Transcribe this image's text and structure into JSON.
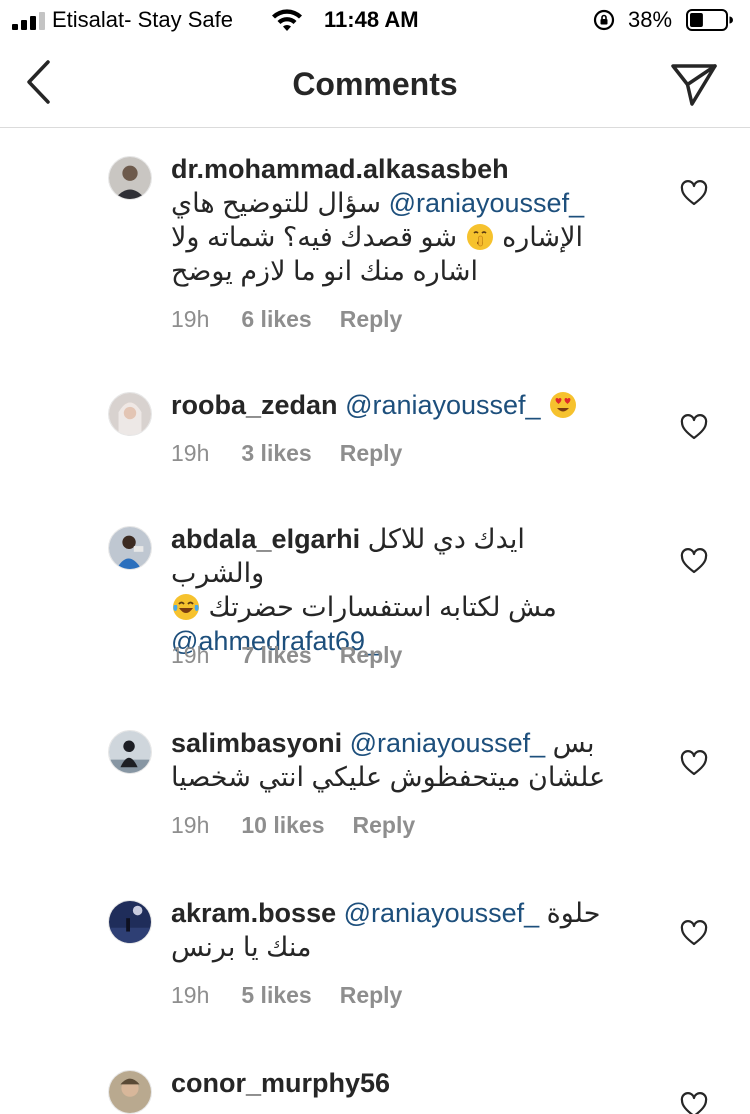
{
  "status_bar": {
    "carrier": "Etisalat- Stay Safe",
    "time": "11:48 AM",
    "battery_percent": "38%",
    "battery_level": 0.38,
    "signal_bars": 3
  },
  "header": {
    "title": "Comments",
    "back_icon": "chevron-left-icon",
    "share_icon": "paper-plane-icon"
  },
  "comments": [
    {
      "username": "dr.mohammad.alkasasbeh",
      "mention": "@raniayoussef_",
      "text_line1": "سؤال للتوضيح هاي",
      "text_line2a": "الإشاره",
      "text_line2b": "شو قصدك فيه؟ شماته ولا",
      "text_line3": "اشاره منك انو ما لازم يوضح",
      "emoji": "shushing-face-emoji",
      "time": "19h",
      "likes": "6 likes",
      "reply": "Reply"
    },
    {
      "username": "rooba_zedan",
      "mention": "@raniayoussef_",
      "emoji": "heart-eyes-emoji",
      "time": "19h",
      "likes": "3 likes",
      "reply": "Reply"
    },
    {
      "username": "abdala_elgarhi",
      "text_line1": "ايدك دي للاكل والشرب",
      "text_line2": "مش لكتابه استفسارات حضرتك",
      "mention": "@ahmedrafat69_",
      "emoji": "tears-of-joy-emoji",
      "time": "19h",
      "likes": "7 likes",
      "reply": "Reply"
    },
    {
      "username": "salimbasyoni",
      "mention": "@raniayoussef_",
      "text_line1": "بس",
      "text_line2": "علشان ميتحفظوش عليكي انتي شخصيا",
      "time": "19h",
      "likes": "10 likes",
      "reply": "Reply"
    },
    {
      "username": "akram.bosse",
      "mention": "@raniayoussef_",
      "text_line1": "حلوة",
      "text_line2": "منك يا برنس",
      "time": "19h",
      "likes": "5 likes",
      "reply": "Reply"
    },
    {
      "username": "conor_murphy56"
    }
  ],
  "colors": {
    "mention": "#1d4f7c",
    "meta": "#8e8e8e",
    "divider": "#dbdbdb"
  }
}
